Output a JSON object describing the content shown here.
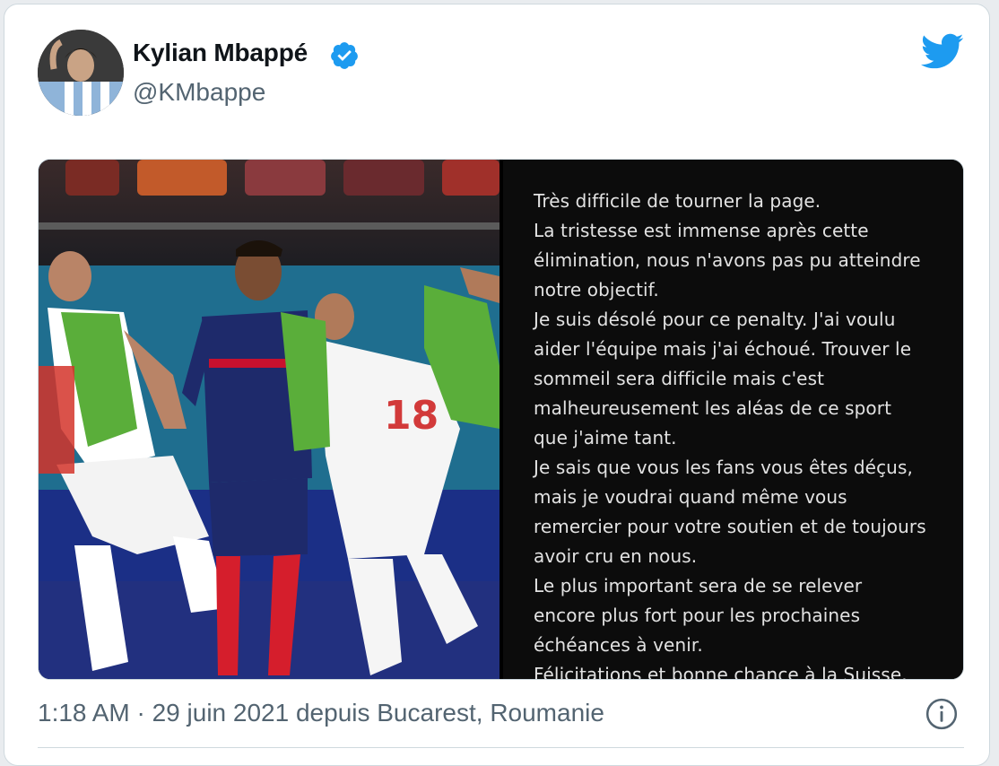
{
  "tweet": {
    "author_name": "Kylian Mbappé",
    "handle": "@KMbappe",
    "verified": true,
    "timestamp": "1:18 AM · 29 juin 2021 depuis Bucarest, Roumanie",
    "brand_color": "#1d9bf0"
  },
  "icons": {
    "verified": "verified-badge-icon",
    "platform": "twitter-bird-icon",
    "info": "info-icon"
  },
  "media": {
    "statement_lines": [
      "Très difficile de tourner la page.",
      "La tristesse est immense après cette",
      "élimination, nous n'avons pas pu atteindre",
      "notre objectif.",
      "Je suis désolé pour ce penalty. J'ai voulu",
      "aider l'équipe mais j'ai échoué. Trouver le",
      "sommeil sera difficile mais c'est",
      "malheureusement les aléas de ce sport",
      "que j'aime tant.",
      "Je sais que vous les fans vous êtes déçus,",
      "mais je voudrai quand même vous",
      "remercier pour votre soutien et de toujours",
      "avoir cru en nous.",
      "Le plus important sera de se relever",
      "encore plus fort pour les prochaines",
      "échéances à venir.",
      "Félicitations et bonne chance à la Suisse."
    ]
  }
}
